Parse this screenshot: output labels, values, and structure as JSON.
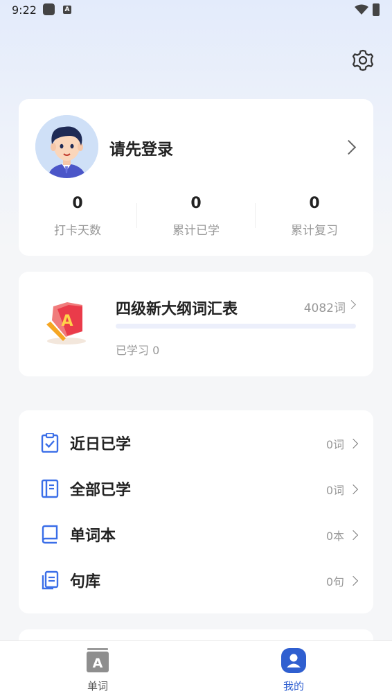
{
  "status_bar": {
    "time": "9:22"
  },
  "profile": {
    "login_prompt": "请先登录",
    "stats": [
      {
        "value": "0",
        "label": "打卡天数"
      },
      {
        "value": "0",
        "label": "累计已学"
      },
      {
        "value": "0",
        "label": "累计复习"
      }
    ]
  },
  "wordbook": {
    "title": "四级新大纲词汇表",
    "word_count": "4082词",
    "learned_label": "已学习 0",
    "progress": 0
  },
  "menu": [
    {
      "label": "近日已学",
      "count": "0词",
      "icon": "checklist-icon"
    },
    {
      "label": "全部已学",
      "count": "0词",
      "icon": "notebook-icon"
    },
    {
      "label": "单词本",
      "count": "0本",
      "icon": "book-icon"
    },
    {
      "label": "句库",
      "count": "0句",
      "icon": "document-stack-icon"
    }
  ],
  "tabbar": {
    "tabs": [
      {
        "label": "单词",
        "icon": "letter-a-card-icon",
        "active": false
      },
      {
        "label": "我的",
        "icon": "user-icon",
        "active": true
      }
    ]
  },
  "colors": {
    "accent": "#2f5fd0",
    "icon_blue": "#3a6ee8",
    "muted_text": "#999999"
  }
}
